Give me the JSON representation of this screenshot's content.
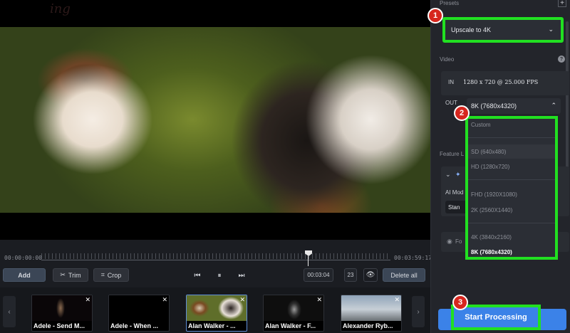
{
  "player": {
    "time_start": "00:00:00:00",
    "time_end": "00:03:59:17"
  },
  "toolbar": {
    "add_label": "Add",
    "trim_label": "Trim",
    "crop_label": "Crop",
    "timecode": "00:03:04",
    "frame": "23",
    "delete_all_label": "Delete all"
  },
  "clips": [
    {
      "label": "Adele - Send M..."
    },
    {
      "label": "Adele - When ..."
    },
    {
      "label": "Alan Walker - ..."
    },
    {
      "label": "Alan Walker - F..."
    },
    {
      "label": "Alexander Ryb..."
    }
  ],
  "panel": {
    "presets_title": "Presets",
    "preset_value": "Upscale to 4K",
    "video_title": "Video",
    "in_label": "IN",
    "in_value": "1280 x 720 @ 25.000 FPS",
    "out_label": "OUT",
    "out_value": "8K (7680x4320)",
    "feature_title": "Feature L",
    "ai_model_label": "AI Mod",
    "ai_model_value": "Stan",
    "feature_row2": "Fo",
    "start_label": "Start Processing"
  },
  "dropdown": {
    "options": [
      "Custom",
      "SD (640x480)",
      "HD (1280x720)",
      "FHD (1920X1080)",
      "2K (2560X1440)",
      "4K (3840x2160)",
      "8K (7680x4320)"
    ],
    "selected": "8K (7680x4320)"
  },
  "callouts": [
    "1",
    "2",
    "3"
  ],
  "colors": {
    "highlight": "#21e021",
    "accent": "#3b82e8",
    "badge": "#d7261e"
  }
}
